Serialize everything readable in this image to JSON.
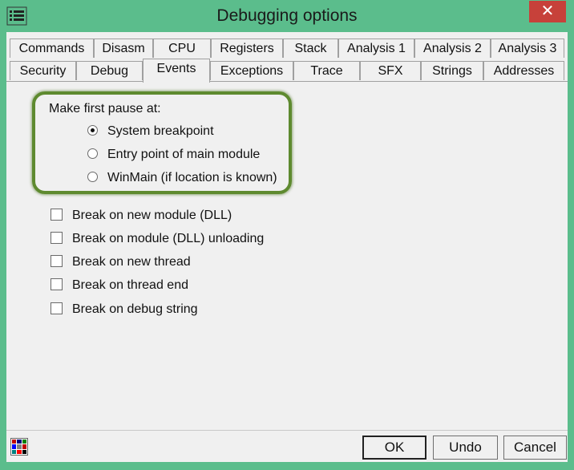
{
  "window": {
    "title": "Debugging options",
    "close_glyph": "✕"
  },
  "tabs": {
    "row1": [
      "Commands",
      "Disasm",
      "CPU",
      "Registers",
      "Stack",
      "Analysis 1",
      "Analysis 2",
      "Analysis 3"
    ],
    "row2": [
      "Security",
      "Debug",
      "Events",
      "Exceptions",
      "Trace",
      "SFX",
      "Strings",
      "Addresses"
    ],
    "active": "Events"
  },
  "events": {
    "first_pause_label": "Make first pause at:",
    "radios": [
      {
        "label": "System breakpoint",
        "selected": true
      },
      {
        "label": "Entry point of main module",
        "selected": false
      },
      {
        "label": "WinMain (if location is known)",
        "selected": false
      }
    ],
    "checkboxes": [
      {
        "label": "Break on new module (DLL)",
        "checked": false
      },
      {
        "label": "Break on module (DLL) unloading",
        "checked": false
      },
      {
        "label": "Break on new thread",
        "checked": false
      },
      {
        "label": "Break on thread end",
        "checked": false
      },
      {
        "label": "Break on debug string",
        "checked": false
      }
    ]
  },
  "buttons": {
    "ok": "OK",
    "undo": "Undo",
    "cancel": "Cancel"
  },
  "icons": {
    "system_menu": "list-icon",
    "palette": "palette-icon",
    "highlight_color": "#5e8a2f"
  }
}
